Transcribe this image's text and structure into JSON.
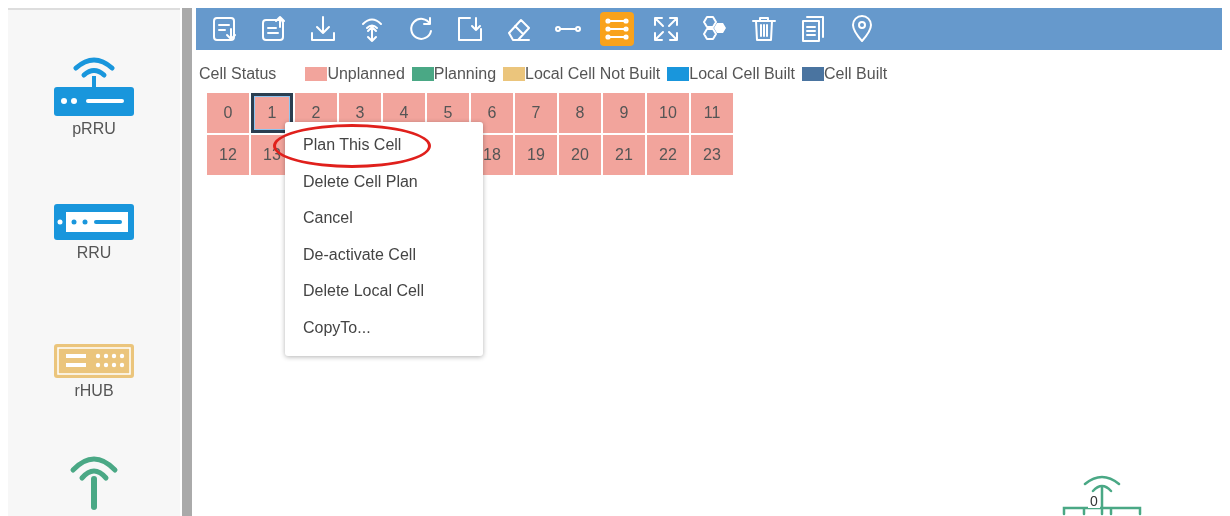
{
  "sidebar": {
    "items": [
      {
        "kind": "prru",
        "label": "pRRU"
      },
      {
        "kind": "rru",
        "label": "RRU"
      },
      {
        "kind": "rhub",
        "label": "rHUB"
      },
      {
        "kind": "antenna"
      }
    ]
  },
  "toolbar": {
    "buttons": [
      {
        "kind": "list-import",
        "selected": false
      },
      {
        "kind": "list-export",
        "selected": false
      },
      {
        "kind": "download",
        "selected": false
      },
      {
        "kind": "signal-updown",
        "selected": false
      },
      {
        "kind": "refresh",
        "selected": false
      },
      {
        "kind": "box-import",
        "selected": false
      },
      {
        "kind": "eraser",
        "selected": false
      },
      {
        "kind": "link",
        "selected": false
      },
      {
        "kind": "cell-list",
        "selected": true
      },
      {
        "kind": "expand",
        "selected": false
      },
      {
        "kind": "hexagons",
        "selected": false
      },
      {
        "kind": "trash",
        "selected": false
      },
      {
        "kind": "document",
        "selected": false
      },
      {
        "kind": "location",
        "selected": false
      }
    ]
  },
  "legend": {
    "title": "Cell Status",
    "items": [
      {
        "label": "Unplanned",
        "color": "#f2a49c"
      },
      {
        "label": "Planning",
        "color": "#4aa885"
      },
      {
        "label": "Local Cell Not Built",
        "color": "#ebc57c"
      },
      {
        "label": "Local Cell Built",
        "color": "#1996dc"
      },
      {
        "label": "Cell Built",
        "color": "#4a74a0"
      }
    ]
  },
  "cells": [
    [
      {
        "label": "0",
        "color": "#f2a49c",
        "selected": false
      },
      {
        "label": "1",
        "color": "#f2a49c",
        "selected": true
      },
      {
        "label": "2",
        "color": "#f2a49c",
        "selected": false
      },
      {
        "label": "3",
        "color": "#f2a49c",
        "selected": false
      },
      {
        "label": "4",
        "color": "#f2a49c",
        "selected": false
      },
      {
        "label": "5",
        "color": "#f2a49c",
        "selected": false
      },
      {
        "label": "6",
        "color": "#f2a49c",
        "selected": false
      },
      {
        "label": "7",
        "color": "#f2a49c",
        "selected": false
      },
      {
        "label": "8",
        "color": "#f2a49c",
        "selected": false
      },
      {
        "label": "9",
        "color": "#f2a49c",
        "selected": false
      },
      {
        "label": "10",
        "color": "#f2a49c",
        "selected": false
      },
      {
        "label": "11",
        "color": "#f2a49c",
        "selected": false
      }
    ],
    [
      {
        "label": "12",
        "color": "#f2a49c",
        "selected": false
      },
      {
        "label": "13",
        "color": "#f2a49c",
        "selected": false
      },
      {
        "label": "18",
        "color": "#f2a49c",
        "selected": false
      },
      {
        "label": "19",
        "color": "#f2a49c",
        "selected": false
      },
      {
        "label": "20",
        "color": "#f2a49c",
        "selected": false
      },
      {
        "label": "21",
        "color": "#f2a49c",
        "selected": false
      },
      {
        "label": "22",
        "color": "#f2a49c",
        "selected": false
      },
      {
        "label": "23",
        "color": "#f2a49c",
        "selected": false
      }
    ]
  ],
  "context_menu": {
    "items": [
      {
        "label": "Plan This Cell",
        "circled": true
      },
      {
        "label": "Delete Cell Plan",
        "circled": false
      },
      {
        "label": "Cancel",
        "circled": false
      },
      {
        "label": "De-activate Cell",
        "circled": false
      },
      {
        "label": "Delete Local Cell",
        "circled": false
      },
      {
        "label": "CopyTo...",
        "circled": false
      }
    ]
  },
  "canvas_node": {
    "kind": "antenna",
    "label": "0"
  }
}
